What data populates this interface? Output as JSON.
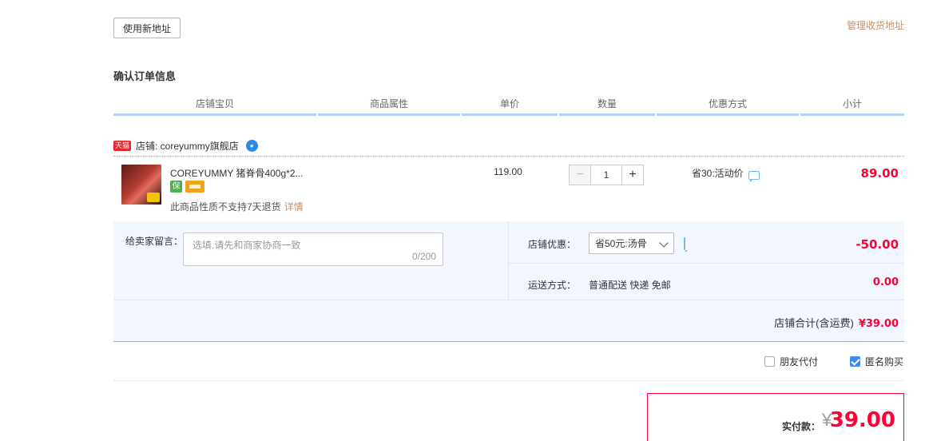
{
  "address": {
    "new_address_button": "使用新地址",
    "manage_link": "管理收货地址"
  },
  "order": {
    "section_title": "确认订单信息",
    "columns": [
      "店铺宝贝",
      "商品属性",
      "单价",
      "数量",
      "优惠方式",
      "小计"
    ]
  },
  "shop": {
    "badge": "天猫",
    "label": "店铺: coreyummy旗舰店"
  },
  "item": {
    "title": "COREYUMMY 猪脊骨400g*2...",
    "badge_icons": [
      "guarantee-icon",
      "card-icon"
    ],
    "return_note": "此商品性质不支持7天退货",
    "detail_link": "详情",
    "unit_price": "119.00",
    "quantity": "1",
    "quantity_minus": "−",
    "quantity_plus": "+",
    "promotion": "省30:活动价",
    "subtotal": "89.00"
  },
  "panel": {
    "message_label": "给卖家留言：",
    "message_placeholder": "选填,请先和商家协商一致",
    "message_count": "0/200",
    "coupon_label": "店铺优惠：",
    "coupon_selected": "省50元:汤骨",
    "coupon_amount": "-50.00",
    "shipping_label": "运送方式：",
    "shipping_value": "普通配送 快递 免邮",
    "shipping_fee": "0.00",
    "shop_total_label": "店铺合计(含运费)",
    "shop_total_amount": "¥39.00"
  },
  "options": {
    "friend_pay": "朋友代付",
    "friend_pay_checked": false,
    "anonymous": "匿名购买",
    "anonymous_checked": true
  },
  "payment": {
    "label": "实付款：",
    "currency": "¥",
    "amount": "39.00"
  },
  "colors": {
    "accent_red": "#ff0036",
    "link_brown": "#c3906a",
    "table_line_blue": "#b2d1ff",
    "panel_bg": "#f2f7ff"
  }
}
